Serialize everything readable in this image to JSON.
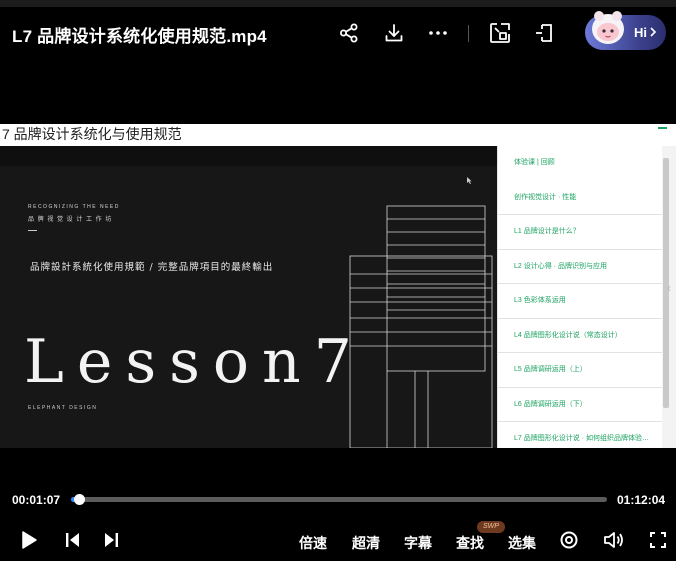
{
  "header": {
    "title": "L7 品牌设计系统化使用规范.mp4",
    "icons": [
      "share-icon",
      "download-icon",
      "more-icon",
      "picture-in-picture-icon",
      "exit-fullscreen-icon"
    ],
    "assistant": {
      "label": "Hi"
    }
  },
  "video": {
    "doc_title": "7 品牌设计系统化与使用规范",
    "slide": {
      "small_en": "RECOGNIZING THE NEED",
      "small_cn": "品 牌 视 觉 设 计 工 作 坊",
      "subtitle": "品牌設計系統化使用規範 / 完整品牌項目的最終輸出",
      "lesson": "Lesson7",
      "brand": "ELEPHANT DESIGN"
    },
    "sidebar_items": [
      "体验课 | 回顾",
      "创作视觉设计 · 性能",
      "L1 品牌设计是什么？",
      "L2 设计心得 · 品牌识别与应用",
      "L3 色彩体系运用",
      "L4 品牌图形化设计说（常态设计）",
      "L5 品牌调研运用（上）",
      "L6 品牌调研运用（下）",
      "L7 品牌图形化设计说 · 如何组织品牌体验…"
    ]
  },
  "player": {
    "current_time": "00:01:07",
    "total_time": "01:12:04",
    "progress": 0.0155,
    "controls": {
      "speed": "倍速",
      "quality": "超清",
      "subtitles": "字幕",
      "search": "查找",
      "search_badge": "SWP",
      "episodes": "选集"
    }
  },
  "colors": {
    "accent": "#2f88ff",
    "sidebar_text": "#1aa260",
    "badge_bg": "#6e3a1f"
  }
}
